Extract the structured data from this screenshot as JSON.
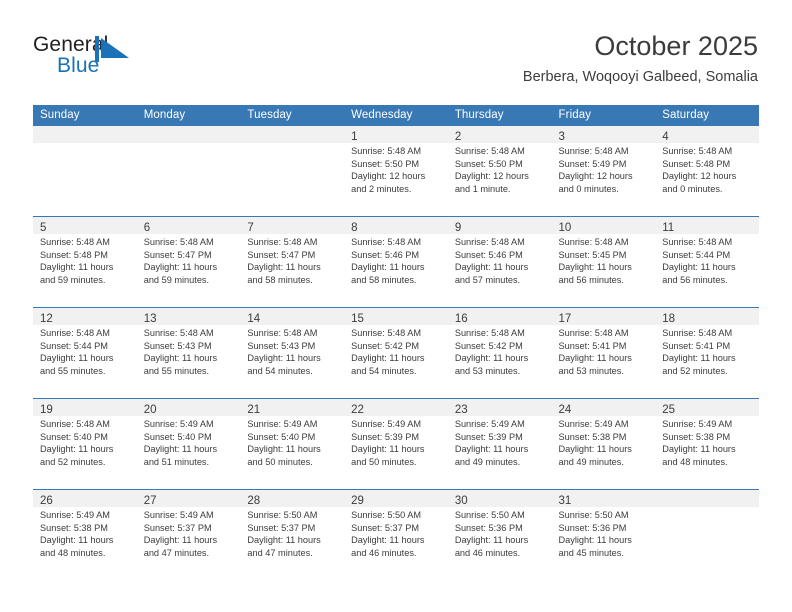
{
  "brand": {
    "name_top": "General",
    "name_bottom": "Blue",
    "logo_icon": "blue-flag-triangle-icon",
    "accent_color": "#1a72b8"
  },
  "header": {
    "month_title": "October 2025",
    "location": "Berbera, Woqooyi Galbeed, Somalia"
  },
  "colors": {
    "header_bg": "#3878b4",
    "header_text": "#ffffff",
    "daynum_band": "#f1f1f1",
    "text": "#3c3c3c",
    "row_divider": "#3878b4"
  },
  "calendar": {
    "weekday_headers": [
      "Sunday",
      "Monday",
      "Tuesday",
      "Wednesday",
      "Thursday",
      "Friday",
      "Saturday"
    ],
    "labels": {
      "sunrise": "Sunrise:",
      "sunset": "Sunset:",
      "daylight": "Daylight:"
    },
    "weeks": [
      [
        {
          "day": "",
          "sunrise": "",
          "sunset": "",
          "daylight_line1": "",
          "daylight_line2": "",
          "empty": true
        },
        {
          "day": "",
          "sunrise": "",
          "sunset": "",
          "daylight_line1": "",
          "daylight_line2": "",
          "empty": true
        },
        {
          "day": "",
          "sunrise": "",
          "sunset": "",
          "daylight_line1": "",
          "daylight_line2": "",
          "empty": true
        },
        {
          "day": "1",
          "sunrise": "Sunrise: 5:48 AM",
          "sunset": "Sunset: 5:50 PM",
          "daylight_line1": "Daylight: 12 hours",
          "daylight_line2": "and 2 minutes.",
          "empty": false
        },
        {
          "day": "2",
          "sunrise": "Sunrise: 5:48 AM",
          "sunset": "Sunset: 5:50 PM",
          "daylight_line1": "Daylight: 12 hours",
          "daylight_line2": "and 1 minute.",
          "empty": false
        },
        {
          "day": "3",
          "sunrise": "Sunrise: 5:48 AM",
          "sunset": "Sunset: 5:49 PM",
          "daylight_line1": "Daylight: 12 hours",
          "daylight_line2": "and 0 minutes.",
          "empty": false
        },
        {
          "day": "4",
          "sunrise": "Sunrise: 5:48 AM",
          "sunset": "Sunset: 5:48 PM",
          "daylight_line1": "Daylight: 12 hours",
          "daylight_line2": "and 0 minutes.",
          "empty": false
        }
      ],
      [
        {
          "day": "5",
          "sunrise": "Sunrise: 5:48 AM",
          "sunset": "Sunset: 5:48 PM",
          "daylight_line1": "Daylight: 11 hours",
          "daylight_line2": "and 59 minutes.",
          "empty": false
        },
        {
          "day": "6",
          "sunrise": "Sunrise: 5:48 AM",
          "sunset": "Sunset: 5:47 PM",
          "daylight_line1": "Daylight: 11 hours",
          "daylight_line2": "and 59 minutes.",
          "empty": false
        },
        {
          "day": "7",
          "sunrise": "Sunrise: 5:48 AM",
          "sunset": "Sunset: 5:47 PM",
          "daylight_line1": "Daylight: 11 hours",
          "daylight_line2": "and 58 minutes.",
          "empty": false
        },
        {
          "day": "8",
          "sunrise": "Sunrise: 5:48 AM",
          "sunset": "Sunset: 5:46 PM",
          "daylight_line1": "Daylight: 11 hours",
          "daylight_line2": "and 58 minutes.",
          "empty": false
        },
        {
          "day": "9",
          "sunrise": "Sunrise: 5:48 AM",
          "sunset": "Sunset: 5:46 PM",
          "daylight_line1": "Daylight: 11 hours",
          "daylight_line2": "and 57 minutes.",
          "empty": false
        },
        {
          "day": "10",
          "sunrise": "Sunrise: 5:48 AM",
          "sunset": "Sunset: 5:45 PM",
          "daylight_line1": "Daylight: 11 hours",
          "daylight_line2": "and 56 minutes.",
          "empty": false
        },
        {
          "day": "11",
          "sunrise": "Sunrise: 5:48 AM",
          "sunset": "Sunset: 5:44 PM",
          "daylight_line1": "Daylight: 11 hours",
          "daylight_line2": "and 56 minutes.",
          "empty": false
        }
      ],
      [
        {
          "day": "12",
          "sunrise": "Sunrise: 5:48 AM",
          "sunset": "Sunset: 5:44 PM",
          "daylight_line1": "Daylight: 11 hours",
          "daylight_line2": "and 55 minutes.",
          "empty": false
        },
        {
          "day": "13",
          "sunrise": "Sunrise: 5:48 AM",
          "sunset": "Sunset: 5:43 PM",
          "daylight_line1": "Daylight: 11 hours",
          "daylight_line2": "and 55 minutes.",
          "empty": false
        },
        {
          "day": "14",
          "sunrise": "Sunrise: 5:48 AM",
          "sunset": "Sunset: 5:43 PM",
          "daylight_line1": "Daylight: 11 hours",
          "daylight_line2": "and 54 minutes.",
          "empty": false
        },
        {
          "day": "15",
          "sunrise": "Sunrise: 5:48 AM",
          "sunset": "Sunset: 5:42 PM",
          "daylight_line1": "Daylight: 11 hours",
          "daylight_line2": "and 54 minutes.",
          "empty": false
        },
        {
          "day": "16",
          "sunrise": "Sunrise: 5:48 AM",
          "sunset": "Sunset: 5:42 PM",
          "daylight_line1": "Daylight: 11 hours",
          "daylight_line2": "and 53 minutes.",
          "empty": false
        },
        {
          "day": "17",
          "sunrise": "Sunrise: 5:48 AM",
          "sunset": "Sunset: 5:41 PM",
          "daylight_line1": "Daylight: 11 hours",
          "daylight_line2": "and 53 minutes.",
          "empty": false
        },
        {
          "day": "18",
          "sunrise": "Sunrise: 5:48 AM",
          "sunset": "Sunset: 5:41 PM",
          "daylight_line1": "Daylight: 11 hours",
          "daylight_line2": "and 52 minutes.",
          "empty": false
        }
      ],
      [
        {
          "day": "19",
          "sunrise": "Sunrise: 5:48 AM",
          "sunset": "Sunset: 5:40 PM",
          "daylight_line1": "Daylight: 11 hours",
          "daylight_line2": "and 52 minutes.",
          "empty": false
        },
        {
          "day": "20",
          "sunrise": "Sunrise: 5:49 AM",
          "sunset": "Sunset: 5:40 PM",
          "daylight_line1": "Daylight: 11 hours",
          "daylight_line2": "and 51 minutes.",
          "empty": false
        },
        {
          "day": "21",
          "sunrise": "Sunrise: 5:49 AM",
          "sunset": "Sunset: 5:40 PM",
          "daylight_line1": "Daylight: 11 hours",
          "daylight_line2": "and 50 minutes.",
          "empty": false
        },
        {
          "day": "22",
          "sunrise": "Sunrise: 5:49 AM",
          "sunset": "Sunset: 5:39 PM",
          "daylight_line1": "Daylight: 11 hours",
          "daylight_line2": "and 50 minutes.",
          "empty": false
        },
        {
          "day": "23",
          "sunrise": "Sunrise: 5:49 AM",
          "sunset": "Sunset: 5:39 PM",
          "daylight_line1": "Daylight: 11 hours",
          "daylight_line2": "and 49 minutes.",
          "empty": false
        },
        {
          "day": "24",
          "sunrise": "Sunrise: 5:49 AM",
          "sunset": "Sunset: 5:38 PM",
          "daylight_line1": "Daylight: 11 hours",
          "daylight_line2": "and 49 minutes.",
          "empty": false
        },
        {
          "day": "25",
          "sunrise": "Sunrise: 5:49 AM",
          "sunset": "Sunset: 5:38 PM",
          "daylight_line1": "Daylight: 11 hours",
          "daylight_line2": "and 48 minutes.",
          "empty": false
        }
      ],
      [
        {
          "day": "26",
          "sunrise": "Sunrise: 5:49 AM",
          "sunset": "Sunset: 5:38 PM",
          "daylight_line1": "Daylight: 11 hours",
          "daylight_line2": "and 48 minutes.",
          "empty": false
        },
        {
          "day": "27",
          "sunrise": "Sunrise: 5:49 AM",
          "sunset": "Sunset: 5:37 PM",
          "daylight_line1": "Daylight: 11 hours",
          "daylight_line2": "and 47 minutes.",
          "empty": false
        },
        {
          "day": "28",
          "sunrise": "Sunrise: 5:50 AM",
          "sunset": "Sunset: 5:37 PM",
          "daylight_line1": "Daylight: 11 hours",
          "daylight_line2": "and 47 minutes.",
          "empty": false
        },
        {
          "day": "29",
          "sunrise": "Sunrise: 5:50 AM",
          "sunset": "Sunset: 5:37 PM",
          "daylight_line1": "Daylight: 11 hours",
          "daylight_line2": "and 46 minutes.",
          "empty": false
        },
        {
          "day": "30",
          "sunrise": "Sunrise: 5:50 AM",
          "sunset": "Sunset: 5:36 PM",
          "daylight_line1": "Daylight: 11 hours",
          "daylight_line2": "and 46 minutes.",
          "empty": false
        },
        {
          "day": "31",
          "sunrise": "Sunrise: 5:50 AM",
          "sunset": "Sunset: 5:36 PM",
          "daylight_line1": "Daylight: 11 hours",
          "daylight_line2": "and 45 minutes.",
          "empty": false
        },
        {
          "day": "",
          "sunrise": "",
          "sunset": "",
          "daylight_line1": "",
          "daylight_line2": "",
          "empty": true
        }
      ]
    ]
  }
}
